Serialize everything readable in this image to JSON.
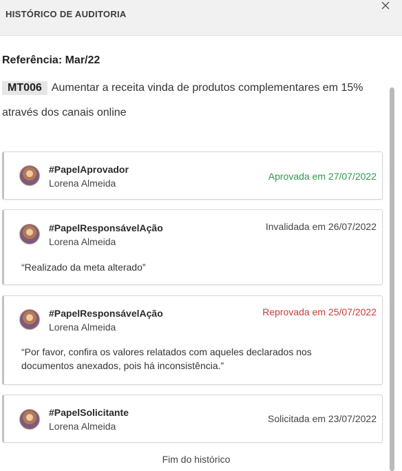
{
  "header": {
    "title": "HISTÓRICO DE AUDITORIA",
    "close_icon": "close-icon"
  },
  "reference": "Referência: Mar/22",
  "goal": {
    "code": "MT006",
    "description": "Aumentar a receita vinda de produtos complementares em 15% através dos canais online"
  },
  "history": [
    {
      "role": "#PapelAprovador",
      "person": "Lorena Almeida",
      "status": "Aprovada em 27/07/2022",
      "status_color": "#2e9a4b",
      "comment": ""
    },
    {
      "role": "#PapelResponsávelAção",
      "person": "Lorena Almeida",
      "status": "Invalidada em 26/07/2022",
      "status_color": "#444444",
      "comment": "“Realizado da meta alterado”"
    },
    {
      "role": "#PapelResponsávelAção",
      "person": "Lorena Almeida",
      "status": "Reprovada em 25/07/2022",
      "status_color": "#c93a3a",
      "comment": "“Por favor, confira os valores relatados com aqueles declarados nos documentos anexados, pois há inconsistência.”"
    },
    {
      "role": "#PapelSolicitante",
      "person": "Lorena Almeida",
      "status": "Solicitada em 23/07/2022",
      "status_color": "#444444",
      "comment": ""
    }
  ],
  "footer": "Fim do histórico"
}
